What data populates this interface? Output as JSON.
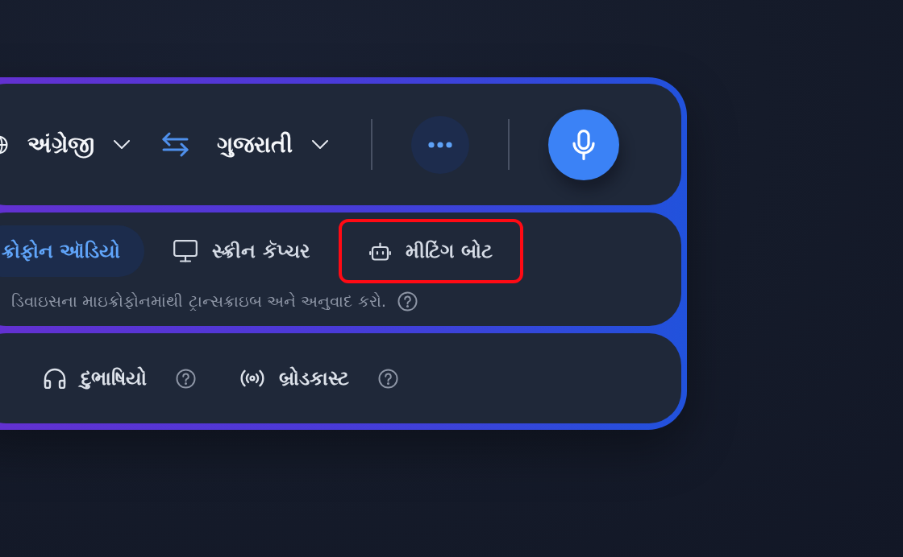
{
  "language_bar": {
    "source_language": {
      "label": "અંગ્રેજી"
    },
    "target_language": {
      "label": "ગુજરાતી"
    }
  },
  "modes": {
    "tabs": [
      {
        "label": "ક્રોફોન ઑડિયો",
        "selected": true,
        "highlighted": false
      },
      {
        "label": "સ્ક્રીન કૅપ્ચર",
        "selected": false,
        "highlighted": false
      },
      {
        "label": "મીટિંગ બોટ",
        "selected": false,
        "highlighted": true
      }
    ],
    "description": "ડિવાઇસના માઇક્રોફોનમાંથી ટ્રાન્સક્રાઇબ અને અનુવાદ કરો."
  },
  "features": [
    {
      "label": "દુભાષિયો"
    },
    {
      "label": "બ્રોડકાસ્ટ"
    }
  ]
}
